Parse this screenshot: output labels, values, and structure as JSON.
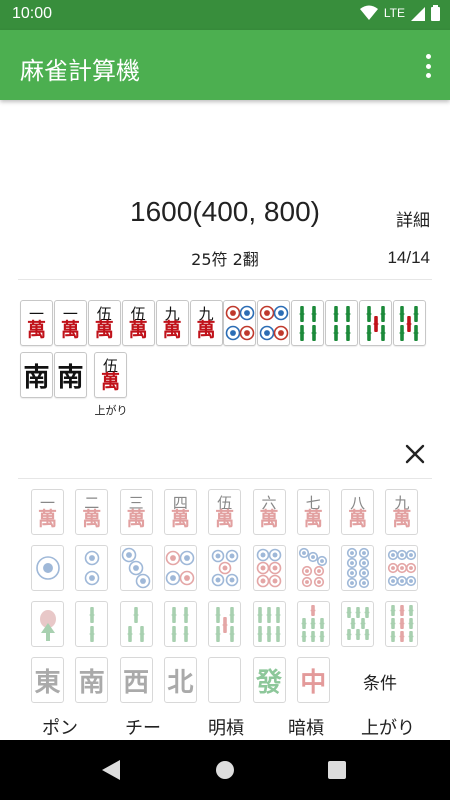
{
  "status_bar": {
    "time": "10:00",
    "network": "LTE",
    "icons": [
      "wifi-icon",
      "signal-icon",
      "battery-icon"
    ]
  },
  "app_bar": {
    "title": "麻雀計算機",
    "menu_icon": "more-vert-icon"
  },
  "result": {
    "score": "1600(400, 800)",
    "detail_label": "詳細",
    "fu_han": "25符  2翻",
    "tile_count": "14/14"
  },
  "hand": {
    "tiles": [
      {
        "kind": "man",
        "num": "一"
      },
      {
        "kind": "man",
        "num": "一"
      },
      {
        "kind": "man",
        "num": "伍"
      },
      {
        "kind": "man",
        "num": "伍"
      },
      {
        "kind": "man",
        "num": "九"
      },
      {
        "kind": "man",
        "num": "九"
      },
      {
        "kind": "pin",
        "num": "4"
      },
      {
        "kind": "pin",
        "num": "4"
      },
      {
        "kind": "sou",
        "num": "4"
      },
      {
        "kind": "sou",
        "num": "4"
      },
      {
        "kind": "sou",
        "num": "5"
      },
      {
        "kind": "sou",
        "num": "5"
      },
      {
        "kind": "honor",
        "char": "南"
      },
      {
        "kind": "honor",
        "char": "南"
      }
    ],
    "winning_tile": {
      "kind": "man",
      "num": "伍"
    },
    "winning_label": "上がり"
  },
  "palette": {
    "man": [
      "一",
      "二",
      "三",
      "四",
      "伍",
      "六",
      "七",
      "八",
      "九"
    ],
    "pin": [
      "1",
      "2",
      "3",
      "4",
      "5",
      "6",
      "7",
      "8",
      "9"
    ],
    "sou": [
      "1",
      "2",
      "3",
      "4",
      "5",
      "6",
      "7",
      "8",
      "9"
    ],
    "honors": [
      "東",
      "南",
      "西",
      "北",
      "",
      "發",
      "中"
    ],
    "conditions_label": "条件"
  },
  "actions": [
    "ポン",
    "チー",
    "明槓",
    "暗槓",
    "上がり"
  ],
  "colors": {
    "primary": "#4CAF50",
    "primary_dark": "#388E3C",
    "man_red": "#c0121a",
    "pin_blue": "#2a6db5",
    "sou_green": "#1c8a3a"
  }
}
